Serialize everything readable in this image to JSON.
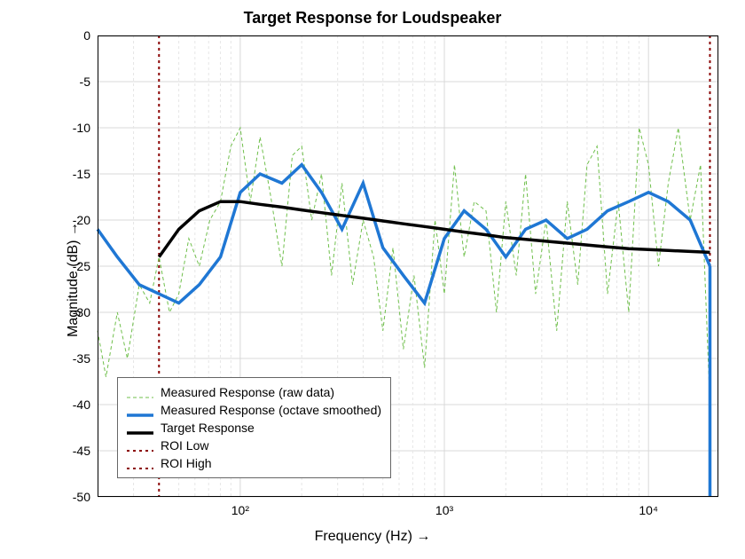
{
  "chart_data": {
    "type": "line",
    "title": "Target Response for Loudspeaker",
    "xlabel": "Frequency  (Hz)   →",
    "ylabel": "Magnitude  (dB)   →",
    "x_scale": "log",
    "xlim": [
      20,
      22000
    ],
    "ylim": [
      -50,
      0
    ],
    "y_ticks": [
      -50,
      -45,
      -40,
      -35,
      -30,
      -25,
      -20,
      -15,
      -10,
      -5,
      0
    ],
    "x_major_ticks": [
      100,
      1000,
      10000
    ],
    "roi_low_hz": 40,
    "roi_high_hz": 20000,
    "legend_position": "lower-left",
    "grid": true,
    "series": [
      {
        "name": "Measured Response (raw data)",
        "style": "green-dashed-thin",
        "x": [
          20,
          22,
          25,
          28,
          32,
          36,
          40,
          45,
          50,
          56,
          63,
          71,
          80,
          90,
          100,
          112,
          125,
          140,
          160,
          180,
          200,
          224,
          250,
          280,
          315,
          355,
          400,
          450,
          500,
          560,
          630,
          710,
          800,
          900,
          1000,
          1120,
          1250,
          1400,
          1600,
          1800,
          2000,
          2250,
          2500,
          2800,
          3150,
          3550,
          4000,
          4500,
          5000,
          5600,
          6300,
          7100,
          8000,
          9000,
          10000,
          11200,
          12500,
          14000,
          16000,
          18000,
          20000
        ],
        "y": [
          -32,
          -37,
          -30,
          -35,
          -27,
          -29,
          -24,
          -30,
          -28,
          -22,
          -25,
          -20,
          -18,
          -12,
          -10,
          -18,
          -11,
          -17,
          -25,
          -13,
          -12,
          -20,
          -15,
          -26,
          -16,
          -27,
          -20,
          -24,
          -32,
          -23,
          -34,
          -26,
          -36,
          -20,
          -28,
          -14,
          -24,
          -18,
          -19,
          -30,
          -18,
          -26,
          -15,
          -28,
          -20,
          -32,
          -18,
          -27,
          -14,
          -12,
          -28,
          -18,
          -30,
          -10,
          -14,
          -25,
          -16,
          -10,
          -20,
          -14,
          -40
        ]
      },
      {
        "name": "Measured Response (octave smoothed)",
        "style": "blue-solid-thick",
        "x": [
          20,
          25,
          32,
          40,
          50,
          63,
          80,
          100,
          125,
          160,
          200,
          250,
          315,
          400,
          500,
          630,
          800,
          1000,
          1250,
          1600,
          2000,
          2500,
          3150,
          4000,
          5000,
          6300,
          8000,
          10000,
          12500,
          16000,
          20000
        ],
        "y": [
          -21,
          -24,
          -27,
          -28,
          -29,
          -27,
          -24,
          -17,
          -15,
          -16,
          -14,
          -17,
          -21,
          -16,
          -23,
          -26,
          -29,
          -22,
          -19,
          -21,
          -24,
          -21,
          -20,
          -22,
          -21,
          -19,
          -18,
          -17,
          -18,
          -20,
          -25
        ]
      },
      {
        "name": "Target Response",
        "style": "black-solid-thick",
        "x": [
          40,
          50,
          63,
          80,
          100,
          125,
          160,
          200,
          250,
          315,
          400,
          500,
          630,
          800,
          1000,
          1250,
          1600,
          2000,
          2500,
          3150,
          4000,
          5000,
          6300,
          8000,
          10000,
          12500,
          16000,
          20000
        ],
        "y": [
          -24,
          -21,
          -19,
          -18,
          -18,
          -18.3,
          -18.6,
          -18.9,
          -19.2,
          -19.5,
          -19.8,
          -20.1,
          -20.4,
          -20.7,
          -21,
          -21.3,
          -21.6,
          -21.9,
          -22.1,
          -22.3,
          -22.5,
          -22.7,
          -22.9,
          -23.1,
          -23.2,
          -23.3,
          -23.4,
          -23.5
        ]
      },
      {
        "name": "ROI Low",
        "style": "darkred-dotted",
        "x_vline": 40
      },
      {
        "name": "ROI High",
        "style": "darkred-dotted",
        "x_vline": 20000
      }
    ]
  },
  "x_ticklabels": {
    "100": "10²",
    "1000": "10³",
    "10000": "10⁴"
  }
}
